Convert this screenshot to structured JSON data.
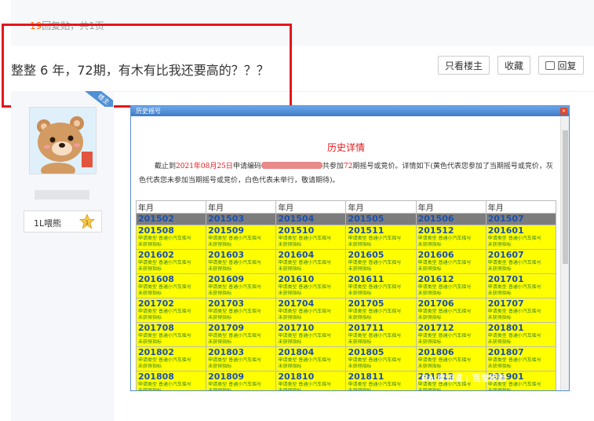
{
  "header": {
    "reply_count": "19",
    "reply_suffix": "回复贴，共1页"
  },
  "thread": {
    "title": "整整 6 年，72期，有木有比我还要高的？？？"
  },
  "buttons": {
    "only_op": "只看楼主",
    "favorite": "收藏",
    "reply": "回复"
  },
  "post": {
    "op_badge": "楼主",
    "level_badge": "1L喂熊",
    "avatar": "bear-avatar-icon"
  },
  "screenshot": {
    "window_title": "历史摇号",
    "heading": "历史详情",
    "desc_prefix": "截止到",
    "desc_date": "2021年08月25日",
    "desc_mid": "申请编码",
    "desc_count_prefix": "共参加",
    "desc_count": "72",
    "desc_rest": "期摇号或竞价。详情如下(黄色代表您参加了当期摇号或竞价，灰色代表您未参加当期摇号或竞价，白色代表未举行，敬请期待)。",
    "col_header": "年月",
    "note_line1": "申请类型 普通小汽车摇号",
    "note_line2": "未获得指标",
    "gray_row": [
      "201502",
      "201503",
      "201504",
      "201505",
      "201506",
      "201507"
    ],
    "yellow_rows": [
      [
        "201508",
        "201509",
        "201510",
        "201511",
        "201512",
        "201601"
      ],
      [
        "201602",
        "201603",
        "201604",
        "201605",
        "201606",
        "201607"
      ],
      [
        "201608",
        "201609",
        "201610",
        "201611",
        "201612",
        "201701"
      ],
      [
        "201702",
        "201703",
        "201704",
        "201705",
        "201706",
        "201707"
      ],
      [
        "201708",
        "201709",
        "201710",
        "201711",
        "201712",
        "201801"
      ],
      [
        "201802",
        "201803",
        "201804",
        "201805",
        "201806",
        "201807"
      ],
      [
        "201808",
        "201809",
        "201810",
        "201811",
        "201812",
        "201901"
      ]
    ],
    "watermark": "Bai度知道 | 百度经验"
  },
  "colors": {
    "highlight_box": "#e5161a",
    "active_row": "#ffff00",
    "inactive_row": "#7c7c7c"
  }
}
